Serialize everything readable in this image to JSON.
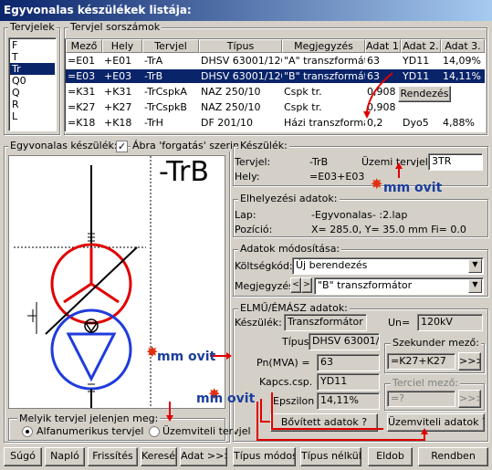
{
  "window": {
    "title": "Egyvonalas készülékek listája:"
  },
  "tervjelek": {
    "label": "Tervjelek",
    "items": [
      "F",
      "T",
      "Tr",
      "Q0",
      "Q",
      "R",
      "L"
    ],
    "selected_index": 2
  },
  "sorszamok": {
    "label": "Tervjel sorszámok",
    "columns": [
      "Mező",
      "Hely",
      "Tervjel",
      "Típus",
      "Megjegyzés",
      "Adat 1.",
      "Adat 2.",
      "Adat 3."
    ],
    "rows": [
      [
        "=E01",
        "+E01",
        "-TrA",
        "DHSV 63001/120",
        "\"A\" transzformátor",
        "63",
        "YD11",
        "14,09%"
      ],
      [
        "=E03",
        "+E03",
        "-TrB",
        "DHSV 63001/120",
        "\"B\" transzformátor",
        "63",
        "YD11",
        "14,11%"
      ],
      [
        "=K31",
        "+K31",
        "-TrCspkA",
        "NAZ 250/10",
        "Cspk tr.",
        "0,908",
        "",
        ""
      ],
      [
        "=K27",
        "+K27",
        "-TrCspkB",
        "NAZ 250/10",
        "Cspk tr.",
        "0,908",
        "",
        ""
      ],
      [
        "=K18",
        "+K18",
        "-TrH",
        "DF 201/10",
        "Házi transzformátor",
        "0,2",
        "Dyo5",
        "4,88%"
      ]
    ],
    "selected_row": 1,
    "rendezes_label": "Rendezés"
  },
  "preview": {
    "label": "Egyvonalas készülék:",
    "check_label": "Ábra 'forgatás' szerint",
    "check_checked": true,
    "big_label": "-TrB"
  },
  "melyik": {
    "label": "Melyik tervjel jelenjen meg:",
    "opt1": "Alfanumerikus tervjel",
    "opt2": "Üzemviteli tervjel",
    "selected": "opt1"
  },
  "keszulek": {
    "label": "Készülék:",
    "tervjel_label": "Tervjel:",
    "tervjel_value": "-TrB",
    "uzemi_label": "Üzemi tervjel:",
    "uzemi_value": "3TR",
    "hely_label": "Hely:",
    "hely_value": "=E03+E03"
  },
  "elhelyezesi": {
    "label": "Elhelyezési adatok:",
    "lap_label": "Lap:",
    "lap_value": "-Egyvonalas- :2.lap",
    "pozicio_label": "Pozíció:",
    "pozicio_value": "X= 285.0, Y=  35.0 mm Fi=     0.0"
  },
  "modositas": {
    "label": "Adatok módosítása:",
    "koltseg_label": "Költségkód:",
    "koltseg_value": "Új berendezés",
    "megj_label": "Megjegyzés:",
    "megj_value": "\"B\" transzformátor"
  },
  "elmu": {
    "label": "ELMŰ/ÉMÁSZ adatok:",
    "keszulek_label": "Készülék:",
    "keszulek_value": "Transzformátor",
    "un_label": "Un=",
    "un_value": "120kV",
    "tipus_label": "Típus:",
    "tipus_value": "DHSV 63001/120",
    "pn_label": "Pn(MVA) =",
    "pn_value": "63",
    "kapcs_label": "Kapcs.csp. =",
    "kapcs_value": "YD11",
    "eps_label": "Epszilon =",
    "eps_value": "14,11%",
    "szek_label": "Szekunder mező:",
    "szek_value": "=K27+K27",
    "szek_btn": ">>>",
    "terciel_label": "Terciel mező:",
    "terciel_value": "=?",
    "terciel_btn": ">>>",
    "bovitett_label": "Bővített adatok ?",
    "uzemviteli_label": "Üzemviteli adatok ?"
  },
  "logo": {
    "text": "mm ovit"
  },
  "bottom": {
    "sugo": "Súgó",
    "naplo": "Napló",
    "frissites": "Frissítés",
    "kereses": "Keresés",
    "adat": "Adat >>>",
    "tipus_mod": "Típus módosít",
    "tipus_nelkul": "Típus nélkül",
    "eldob": "Eldob",
    "rendben": "Rendben"
  },
  "colors": {
    "title_start": "#0a246a",
    "title_end": "#a6caf0",
    "selection": "#0a246a",
    "accent_red": "#e00000",
    "logo_blue": "#1a3e9c"
  }
}
